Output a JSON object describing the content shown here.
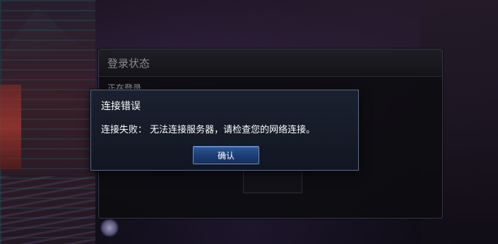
{
  "login_panel": {
    "title": "登录状态",
    "status_text": "正在登录……"
  },
  "error_dialog": {
    "title": "连接错误",
    "message": "连接失败： 无法连接服务器，请检查您的网络连接。",
    "confirm_label": "确认"
  },
  "colors": {
    "dialog_border": "#5b6a86",
    "button_fill": "#1d4078",
    "button_border": "#6f93c4"
  }
}
